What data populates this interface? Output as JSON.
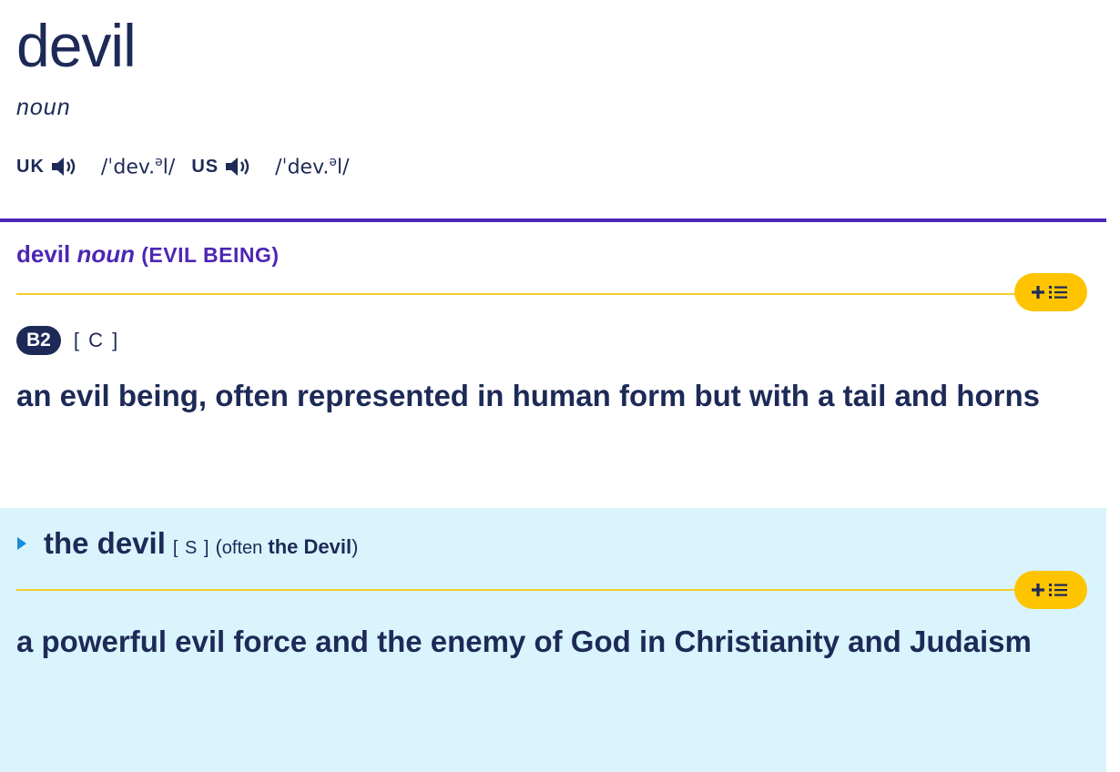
{
  "entry": {
    "headword": "devil",
    "pos": "noun",
    "pronunciations": [
      {
        "region": "UK",
        "ipa_pre": "/ˈdev.",
        "ipa_sup": "ə",
        "ipa_post": "l/"
      },
      {
        "region": "US",
        "ipa_pre": "/ˈdev.",
        "ipa_sup": "ə",
        "ipa_post": "l/"
      }
    ]
  },
  "sense": {
    "word": "devil",
    "pos": "noun",
    "guideword": "(EVIL BEING)",
    "level": "B2",
    "grammar": "[ C ]",
    "definition": "an evil being, often represented in human form but with a tail and horns"
  },
  "phrase": {
    "text": "the devil",
    "grammar": "[ S ]",
    "note_open": "(",
    "note_word": "often",
    "note_variant": "the Devil",
    "note_close": ")",
    "definition": "a powerful evil force and the enemy of God in Christianity and Judaism"
  },
  "icons": {
    "audio": "speaker-icon",
    "add_to_list": "plus-list-icon",
    "expand": "triangle-right-icon"
  },
  "colors": {
    "text": "#1d2a57",
    "accent_purple": "#4d27b4",
    "yellow": "#fec400",
    "phrase_bg": "#d9f4fc",
    "expand_blue": "#1a8cd8"
  }
}
